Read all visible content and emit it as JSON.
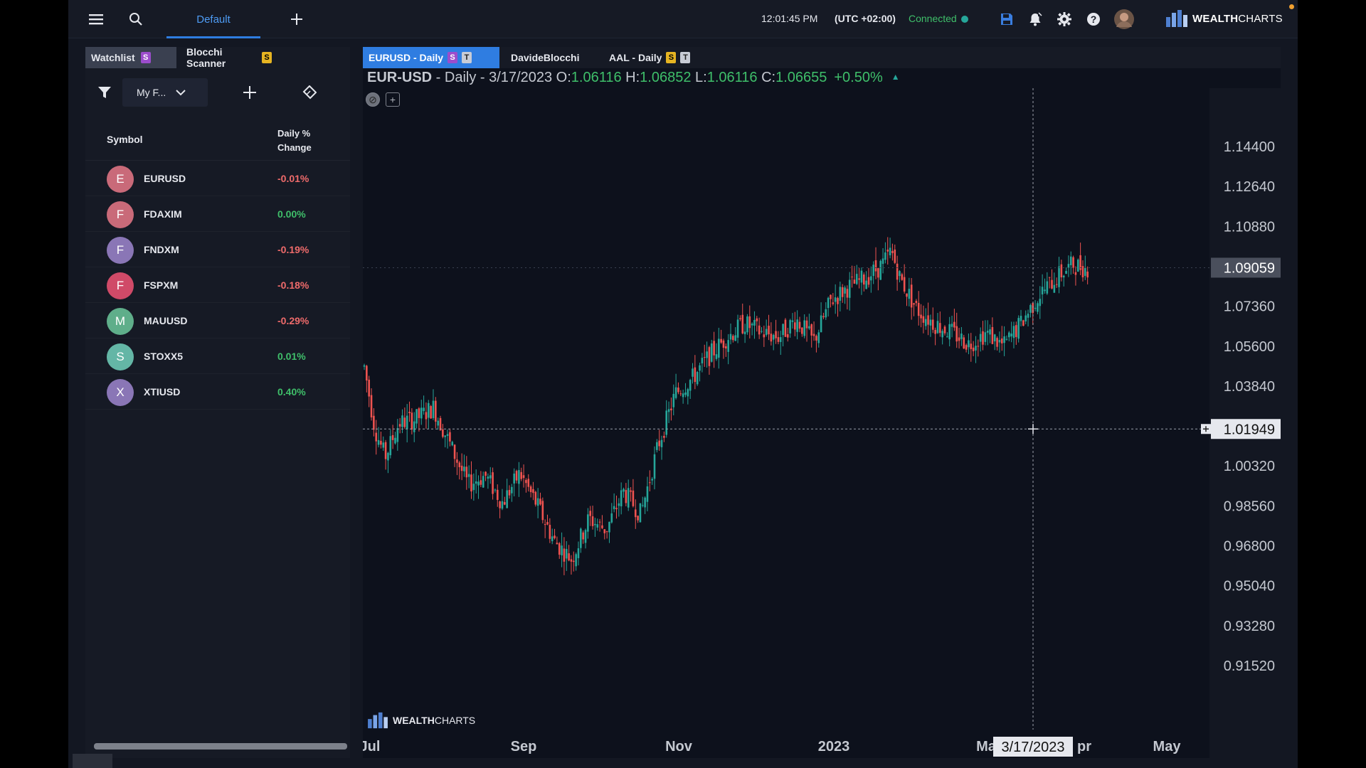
{
  "topbar": {
    "tab_label": "Default",
    "time": "12:01:45 PM",
    "timezone": "(UTC +02:00)",
    "connection": "Connected",
    "brand_bold": "WEALTH",
    "brand_light": "CHARTS"
  },
  "leftpanel": {
    "tabs": [
      {
        "label": "Watchlist",
        "badge": "S"
      },
      {
        "label": "Blocchi Scanner",
        "badge": "S"
      }
    ],
    "filter_label": "My F...",
    "header_symbol": "Symbol",
    "header_change": "Daily % Change",
    "rows": [
      {
        "letter": "E",
        "symbol": "EURUSD",
        "change": "-0.01%",
        "color": "#c96a79",
        "dir": "down"
      },
      {
        "letter": "F",
        "symbol": "FDAXIM",
        "change": "0.00%",
        "color": "#c96a79",
        "dir": "up"
      },
      {
        "letter": "F",
        "symbol": "FNDXM",
        "change": "-0.19%",
        "color": "#8a76b6",
        "dir": "down"
      },
      {
        "letter": "F",
        "symbol": "FSPXM",
        "change": "-0.18%",
        "color": "#d04a68",
        "dir": "down"
      },
      {
        "letter": "M",
        "symbol": "MAUUSD",
        "change": "-0.29%",
        "color": "#5fae8a",
        "dir": "down"
      },
      {
        "letter": "S",
        "symbol": "STOXX5",
        "change": "0.01%",
        "color": "#64b6a6",
        "dir": "up"
      },
      {
        "letter": "X",
        "symbol": "XTIUSD",
        "change": "0.40%",
        "color": "#8a76b6",
        "dir": "up"
      }
    ]
  },
  "chart_tabs": [
    {
      "label": "EURUSD - Daily",
      "badges": [
        "S",
        "T"
      ]
    },
    {
      "label": "DavideBlocchi",
      "badges": []
    },
    {
      "label": "AAL - Daily",
      "badges": [
        "S",
        "T"
      ]
    }
  ],
  "ohlc": {
    "symbol": "EUR-USD",
    "sep1": " - Daily - ",
    "date": "3/17/2023",
    "o_label": " O:",
    "o": "1.06116",
    "h_label": " H:",
    "h": "1.06852",
    "l_label": " L:",
    "l": "1.06116",
    "c_label": " C:",
    "c": "1.06655",
    "pct": "+0.50%"
  },
  "watermark_bold": "WEALTH",
  "watermark_light": "CHARTS",
  "colors": {
    "up": "#26a69a",
    "down": "#ef5350",
    "accent": "#2f7de1"
  },
  "chart_data": {
    "type": "candlestick",
    "y_ticks": [
      "1.14400",
      "1.12640",
      "1.10880",
      "1.07360",
      "1.05600",
      "1.03840",
      "1.00320",
      "0.98560",
      "0.96800",
      "0.95040",
      "0.93280",
      "0.91520"
    ],
    "ylim": [
      0.9064,
      1.1528
    ],
    "x_labels": [
      "Jul",
      "Sep",
      "Nov",
      "2023",
      "Ma",
      "pr",
      "May"
    ],
    "last_price_label": "1.09059",
    "last_price": 1.09059,
    "crosshair_price_label": "1.01949",
    "crosshair_price": 1.01949,
    "crosshair_date": "3/17/2023",
    "close_path": [
      [
        0,
        1.047
      ],
      [
        6,
        1.02
      ],
      [
        12,
        1.007
      ],
      [
        20,
        1.022
      ],
      [
        30,
        1.024
      ],
      [
        40,
        1.029
      ],
      [
        50,
        1.012
      ],
      [
        60,
        0.995
      ],
      [
        70,
        0.999
      ],
      [
        80,
        0.987
      ],
      [
        90,
        1.0
      ],
      [
        100,
        0.986
      ],
      [
        110,
        0.97
      ],
      [
        120,
        0.962
      ],
      [
        130,
        0.98
      ],
      [
        140,
        0.975
      ],
      [
        150,
        0.992
      ],
      [
        160,
        0.982
      ],
      [
        170,
        1.012
      ],
      [
        180,
        1.035
      ],
      [
        190,
        1.042
      ],
      [
        200,
        1.052
      ],
      [
        210,
        1.06
      ],
      [
        220,
        1.066
      ],
      [
        230,
        1.062
      ],
      [
        240,
        1.06
      ],
      [
        250,
        1.068
      ],
      [
        260,
        1.058
      ],
      [
        270,
        1.076
      ],
      [
        280,
        1.082
      ],
      [
        290,
        1.086
      ],
      [
        300,
        1.092
      ],
      [
        305,
        1.098
      ],
      [
        310,
        1.086
      ],
      [
        320,
        1.072
      ],
      [
        330,
        1.066
      ],
      [
        340,
        1.062
      ],
      [
        350,
        1.057
      ],
      [
        360,
        1.062
      ],
      [
        370,
        1.056
      ],
      [
        380,
        1.066
      ],
      [
        390,
        1.078
      ],
      [
        400,
        1.086
      ],
      [
        410,
        1.092
      ],
      [
        420,
        1.09
      ]
    ]
  }
}
